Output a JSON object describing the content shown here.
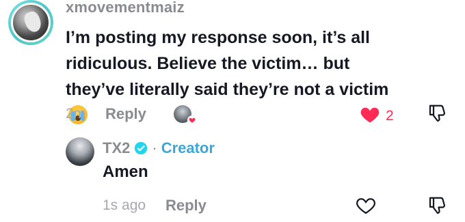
{
  "comment": {
    "username": "xmovementmaiz",
    "text": "I’m posting my response soon, it’s all ridiculous. Believe the victim… but they’ve literally said they’re not a victim",
    "emoji": "loudly-crying-face-emoji",
    "time": "2m",
    "reply_label": "Reply",
    "likes": "2",
    "liked_by_creator": true,
    "like_color": "#fe2c55"
  },
  "reply": {
    "username": "TX2",
    "verified": true,
    "separator": "·",
    "role": "Creator",
    "role_color": "#3aa8d6",
    "text": "Amen",
    "time": "1s ago",
    "reply_label": "Reply"
  }
}
